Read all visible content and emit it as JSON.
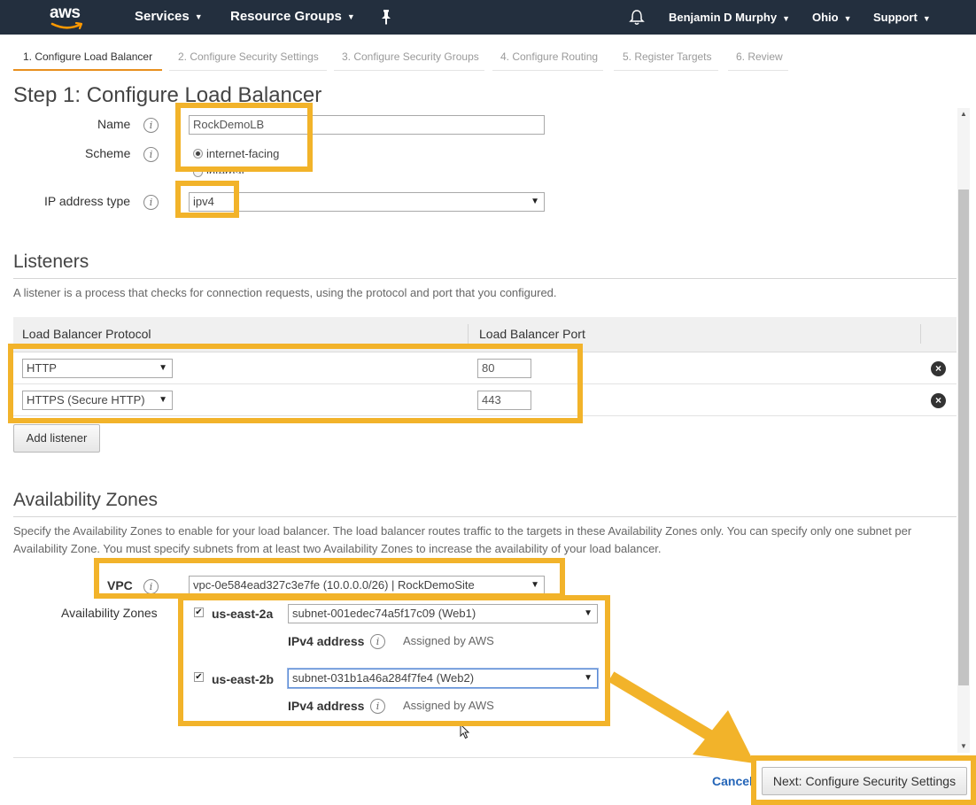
{
  "nav": {
    "logo": "aws",
    "services": "Services",
    "resource_groups": "Resource Groups",
    "user": "Benjamin D Murphy",
    "region": "Ohio",
    "support": "Support"
  },
  "tabs": [
    {
      "label": "1. Configure Load Balancer",
      "active": true
    },
    {
      "label": "2. Configure Security Settings",
      "active": false
    },
    {
      "label": "3. Configure Security Groups",
      "active": false
    },
    {
      "label": "4. Configure Routing",
      "active": false
    },
    {
      "label": "5. Register Targets",
      "active": false
    },
    {
      "label": "6. Review",
      "active": false
    }
  ],
  "step_title": "Step 1: Configure Load Balancer",
  "basic": {
    "name_label": "Name",
    "name_value": "RockDemoLB",
    "scheme_label": "Scheme",
    "scheme_options": [
      "internet-facing",
      "internal"
    ],
    "scheme_selected": "internet-facing",
    "ip_label": "IP address type",
    "ip_value": "ipv4"
  },
  "listeners": {
    "title": "Listeners",
    "description": "A listener is a process that checks for connection requests, using the protocol and port that you configured.",
    "col_protocol": "Load Balancer Protocol",
    "col_port": "Load Balancer Port",
    "rows": [
      {
        "protocol": "HTTP",
        "port": "80"
      },
      {
        "protocol": "HTTPS (Secure HTTP)",
        "port": "443"
      }
    ],
    "add_label": "Add listener"
  },
  "az": {
    "title": "Availability Zones",
    "description": "Specify the Availability Zones to enable for your load balancer. The load balancer routes traffic to the targets in these Availability Zones only. You can specify only one subnet per Availability Zone. You must specify subnets from at least two Availability Zones to increase the availability of your load balancer.",
    "vpc_label": "VPC",
    "vpc_value": "vpc-0e584ead327c3e7fe (10.0.0.0/26) | RockDemoSite",
    "zones_label": "Availability Zones",
    "zones": [
      {
        "zone": "us-east-2a",
        "subnet": "subnet-001edec74a5f17c09 (Web1)",
        "ipv4_label": "IPv4 address",
        "ipv4_value": "Assigned by AWS"
      },
      {
        "zone": "us-east-2b",
        "subnet": "subnet-031b1a46a284f7fe4 (Web2)",
        "ipv4_label": "IPv4 address",
        "ipv4_value": "Assigned by AWS"
      }
    ]
  },
  "footer": {
    "cancel": "Cancel",
    "next": "Next: Configure Security Settings"
  },
  "colors": {
    "nav_bg": "#232f3e",
    "highlight": "#f2b32a",
    "active_tab": "#e88f1e",
    "link": "#2465b8"
  }
}
